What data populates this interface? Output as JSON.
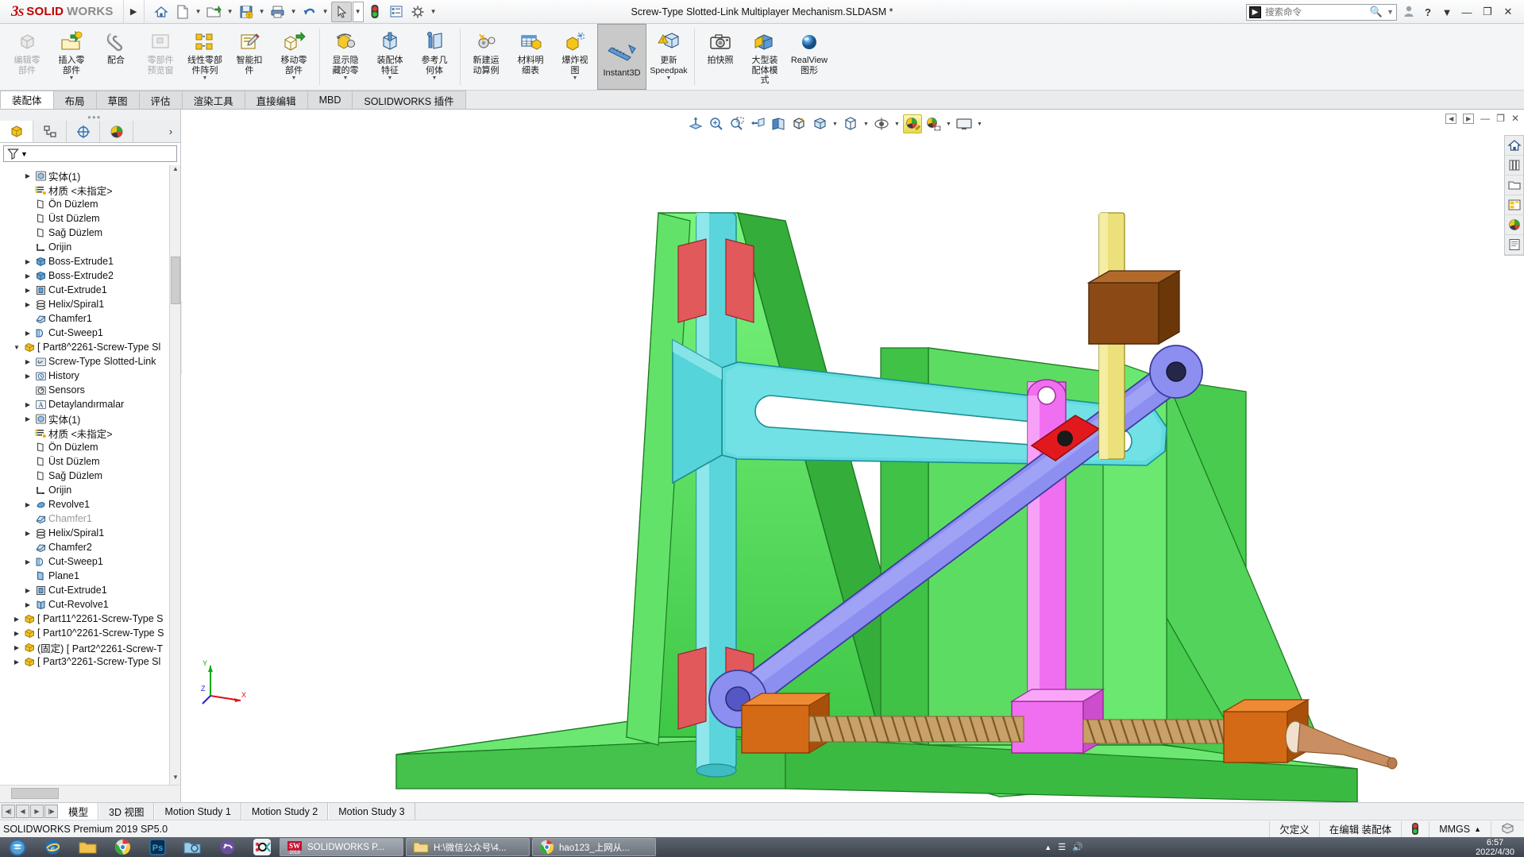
{
  "titlebar": {
    "brand_ds": "3S",
    "brand_solid": "SOLID",
    "brand_works": "WORKS",
    "document_title": "Screw-Type Slotted-Link Multiplayer Mechanism.SLDASM *",
    "quick_access": [
      {
        "name": "home-icon",
        "label": "⌂"
      },
      {
        "name": "new-document-icon",
        "label": "὜B"
      },
      {
        "name": "open-folder-icon",
        "label": "open"
      },
      {
        "name": "save-icon",
        "label": "save"
      },
      {
        "name": "print-icon",
        "label": "print"
      },
      {
        "name": "undo-icon",
        "label": "undo"
      },
      {
        "name": "select-cursor-icon",
        "label": "select"
      },
      {
        "name": "rebuild-traffic-light-icon",
        "label": "rebuild"
      },
      {
        "name": "options-list-icon",
        "label": "list"
      },
      {
        "name": "settings-gear-icon",
        "label": "gear"
      }
    ],
    "search": {
      "placeholder": "搜索命令",
      "value": ""
    },
    "user_icon": "user-icon",
    "help_label": "?",
    "minimize": "—",
    "restore": "❐",
    "close": "✕"
  },
  "ribbon": {
    "items": [
      {
        "label": "编辑零\n部件",
        "name": "edit-component-button",
        "enabled": false,
        "icon": "edit-component-icon"
      },
      {
        "label": "插入零\n部件",
        "name": "insert-components-button",
        "enabled": true,
        "icon": "insert-component-icon",
        "caret": true
      },
      {
        "label": "配合",
        "name": "mate-button",
        "enabled": true,
        "icon": "mate-icon"
      },
      {
        "label": "零部件\n预览窗",
        "name": "component-preview-window-button",
        "enabled": false,
        "icon": "component-preview-icon"
      },
      {
        "label": "线性零部\n件阵列",
        "name": "linear-component-pattern-button",
        "enabled": true,
        "icon": "linear-pattern-icon",
        "caret": true
      },
      {
        "label": "智能扣\n件",
        "name": "smart-fasteners-button",
        "enabled": true,
        "icon": "smart-fastener-icon"
      },
      {
        "label": "移动零\n部件",
        "name": "move-component-button",
        "enabled": true,
        "icon": "move-component-icon",
        "caret": true
      },
      {
        "sep": true
      },
      {
        "label": "显示隐\n藏的零",
        "name": "show-hidden-components-button",
        "enabled": true,
        "icon": "show-hidden-icon",
        "caret": true
      },
      {
        "label": "装配体\n特征",
        "name": "assembly-features-button",
        "enabled": true,
        "icon": "assembly-feature-icon",
        "caret": true
      },
      {
        "label": "参考几\n何体",
        "name": "reference-geometry-button",
        "enabled": true,
        "icon": "reference-geometry-icon",
        "caret": true
      },
      {
        "sep": true
      },
      {
        "label": "新建运\n动算例",
        "name": "new-motion-study-button",
        "enabled": true,
        "icon": "motion-study-icon"
      },
      {
        "label": "材料明\n细表",
        "name": "bill-of-materials-button",
        "enabled": true,
        "icon": "bom-icon"
      },
      {
        "label": "爆炸视\n图",
        "name": "exploded-view-button",
        "enabled": true,
        "icon": "exploded-view-icon",
        "caret": true
      },
      {
        "label": "Instant3D",
        "name": "instant3d-button",
        "enabled": true,
        "active": true,
        "icon": "instant3d-icon"
      },
      {
        "label": "更新\nSpeedpak",
        "name": "update-speedpak-button",
        "enabled": true,
        "icon": "update-speedpak-icon",
        "caret": true
      },
      {
        "sep": true
      },
      {
        "label": "拍快照",
        "name": "take-snapshot-button",
        "enabled": true,
        "icon": "snapshot-camera-icon"
      },
      {
        "label": "大型装\n配体模\n式",
        "name": "large-assembly-mode-button",
        "enabled": true,
        "icon": "large-assembly-icon"
      },
      {
        "label": "RealView\n图形",
        "name": "realview-graphics-button",
        "enabled": true,
        "icon": "realview-sphere-icon"
      }
    ]
  },
  "tabs": [
    {
      "label": "装配体",
      "name": "tab-assembly",
      "selected": true
    },
    {
      "label": "布局",
      "name": "tab-layout",
      "selected": false
    },
    {
      "label": "草图",
      "name": "tab-sketch",
      "selected": false
    },
    {
      "label": "评估",
      "name": "tab-evaluate",
      "selected": false
    },
    {
      "label": "渲染工具",
      "name": "tab-render-tools",
      "selected": false
    },
    {
      "label": "直接编辑",
      "name": "tab-direct-editing",
      "selected": false
    },
    {
      "label": "MBD",
      "name": "tab-mbd",
      "selected": false
    },
    {
      "label": "SOLIDWORKS 插件",
      "name": "tab-solidworks-addins",
      "selected": false
    }
  ],
  "left_panel": {
    "tabs": [
      {
        "name": "feature-manager-tab",
        "icon": "feature-tree-icon",
        "selected": true
      },
      {
        "name": "property-manager-tab",
        "icon": "property-manager-icon",
        "selected": false
      },
      {
        "name": "configuration-manager-tab",
        "icon": "configuration-icon",
        "selected": false
      },
      {
        "name": "display-manager-tab",
        "icon": "display-manager-icon",
        "selected": false
      }
    ],
    "filter_placeholder": "",
    "tree": [
      {
        "label": "实体(1)",
        "indent": 2,
        "arrow": true,
        "icon": "solid-bodies-icon"
      },
      {
        "label": "材质 <未指定>",
        "indent": 2,
        "arrow": false,
        "icon": "material-icon"
      },
      {
        "label": "Ön Düzlem",
        "indent": 2,
        "arrow": false,
        "icon": "plane-icon"
      },
      {
        "label": "Üst Düzlem",
        "indent": 2,
        "arrow": false,
        "icon": "plane-icon"
      },
      {
        "label": "Sağ Düzlem",
        "indent": 2,
        "arrow": false,
        "icon": "plane-icon"
      },
      {
        "label": "Orijin",
        "indent": 2,
        "arrow": false,
        "icon": "origin-icon"
      },
      {
        "label": "Boss-Extrude1",
        "indent": 2,
        "arrow": true,
        "icon": "boss-extrude-icon"
      },
      {
        "label": "Boss-Extrude2",
        "indent": 2,
        "arrow": true,
        "icon": "boss-extrude-icon"
      },
      {
        "label": "Cut-Extrude1",
        "indent": 2,
        "arrow": true,
        "icon": "cut-extrude-icon"
      },
      {
        "label": "Helix/Spiral1",
        "indent": 2,
        "arrow": true,
        "icon": "helix-icon"
      },
      {
        "label": "Chamfer1",
        "indent": 2,
        "arrow": false,
        "icon": "chamfer-icon"
      },
      {
        "label": "Cut-Sweep1",
        "indent": 2,
        "arrow": true,
        "icon": "cut-sweep-icon"
      },
      {
        "label": "[ Part8^2261-Screw-Type Sl",
        "indent": 1,
        "arrow": true,
        "expanded": true,
        "icon": "component-icon"
      },
      {
        "label": "Screw-Type Slotted-Link",
        "indent": 2,
        "arrow": true,
        "icon": "mates-folder-icon"
      },
      {
        "label": "History",
        "indent": 2,
        "arrow": true,
        "icon": "history-icon"
      },
      {
        "label": "Sensors",
        "indent": 2,
        "arrow": false,
        "icon": "sensors-icon"
      },
      {
        "label": "Detaylandırmalar",
        "indent": 2,
        "arrow": true,
        "icon": "annotations-icon"
      },
      {
        "label": "实体(1)",
        "indent": 2,
        "arrow": true,
        "icon": "solid-bodies-icon"
      },
      {
        "label": "材质 <未指定>",
        "indent": 2,
        "arrow": false,
        "icon": "material-icon"
      },
      {
        "label": "Ön Düzlem",
        "indent": 2,
        "arrow": false,
        "icon": "plane-icon"
      },
      {
        "label": "Üst Düzlem",
        "indent": 2,
        "arrow": false,
        "icon": "plane-icon"
      },
      {
        "label": "Sağ Düzlem",
        "indent": 2,
        "arrow": false,
        "icon": "plane-icon"
      },
      {
        "label": "Orijin",
        "indent": 2,
        "arrow": false,
        "icon": "origin-icon"
      },
      {
        "label": "Revolve1",
        "indent": 2,
        "arrow": true,
        "icon": "revolve-icon"
      },
      {
        "label": "Chamfer1",
        "indent": 2,
        "arrow": false,
        "icon": "chamfer-icon",
        "greyed": true
      },
      {
        "label": "Helix/Spiral1",
        "indent": 2,
        "arrow": true,
        "icon": "helix-icon"
      },
      {
        "label": "Chamfer2",
        "indent": 2,
        "arrow": false,
        "icon": "chamfer-icon"
      },
      {
        "label": "Cut-Sweep1",
        "indent": 2,
        "arrow": true,
        "icon": "cut-sweep-icon"
      },
      {
        "label": "Plane1",
        "indent": 2,
        "arrow": false,
        "icon": "plane-blue-icon"
      },
      {
        "label": "Cut-Extrude1",
        "indent": 2,
        "arrow": true,
        "icon": "cut-extrude-icon"
      },
      {
        "label": "Cut-Revolve1",
        "indent": 2,
        "arrow": true,
        "icon": "cut-revolve-icon"
      },
      {
        "label": "[ Part11^2261-Screw-Type S",
        "indent": 1,
        "arrow": true,
        "icon": "component-icon"
      },
      {
        "label": "[ Part10^2261-Screw-Type S",
        "indent": 1,
        "arrow": true,
        "icon": "component-icon"
      },
      {
        "label": "(固定) [ Part2^2261-Screw-T",
        "indent": 1,
        "arrow": true,
        "icon": "component-icon"
      },
      {
        "label": "[ Part3^2261-Screw-Type Sl",
        "indent": 1,
        "arrow": true,
        "icon": "component-icon"
      }
    ]
  },
  "viewport": {
    "hud": [
      {
        "name": "zoom-to-fit-icon",
        "label": "fit"
      },
      {
        "name": "zoom-to-area-icon",
        "label": "area"
      },
      {
        "name": "previous-view-icon",
        "label": "prev"
      },
      {
        "name": "section-view-icon",
        "label": "section"
      },
      {
        "name": "view-orientation-icon",
        "label": "orient"
      },
      {
        "name": "display-style-icon",
        "label": "style",
        "caret": true
      },
      {
        "name": "hide-show-items-icon",
        "label": "hideshow",
        "caret": true
      },
      {
        "name": "edit-appearance-icon",
        "label": "appearance",
        "highlight": true
      },
      {
        "name": "apply-scene-icon",
        "label": "scene",
        "caret": true
      },
      {
        "name": "view-settings-icon",
        "label": "viewsettings",
        "caret": true
      }
    ],
    "window_buttons": [
      {
        "name": "restore-down-left-button",
        "label": "◁"
      },
      {
        "name": "restore-down-right-button",
        "label": "▷"
      },
      {
        "name": "minimize-doc-button",
        "label": "—"
      },
      {
        "name": "maximize-doc-button",
        "label": "❐"
      },
      {
        "name": "close-doc-button",
        "label": "✕"
      }
    ],
    "right_dock": [
      {
        "name": "sw-resources-home-icon"
      },
      {
        "name": "design-library-icon"
      },
      {
        "name": "file-explorer-icon"
      },
      {
        "name": "view-palette-icon"
      },
      {
        "name": "appearances-scenes-icon"
      },
      {
        "name": "custom-properties-icon"
      }
    ],
    "triad": {
      "x": "X",
      "y": "Y",
      "z": "Z"
    },
    "model_colors": {
      "base_green": "#55e05a",
      "base_green_dark": "#2fae34",
      "cyan_arm": "#57d8dd",
      "blue_link": "#8c8ef0",
      "magenta_slider": "#f06ff0",
      "brown_block": "#8b4a15",
      "orange_block": "#d46a16",
      "red_pad": "#e2595c",
      "yellow_rod": "#ece07a",
      "tan_screw": "#d9a978"
    }
  },
  "bottom": {
    "nav_buttons": [
      "◀|",
      "◀",
      "▶",
      "|▶"
    ],
    "tabs": [
      {
        "label": "模型",
        "name": "bottom-tab-model",
        "selected": true
      },
      {
        "label": "3D 视图",
        "name": "bottom-tab-3d-views",
        "selected": false
      },
      {
        "label": "Motion Study 1",
        "name": "bottom-tab-motion-study-1",
        "selected": false
      },
      {
        "label": "Motion Study 2",
        "name": "bottom-tab-motion-study-2",
        "selected": false
      },
      {
        "label": "Motion Study 3",
        "name": "bottom-tab-motion-study-3",
        "selected": false
      }
    ]
  },
  "status": {
    "version": "SOLIDWORKS Premium 2019 SP5.0",
    "state": "欠定义",
    "editing": "在编辑 装配体",
    "rebuild_icon": "rebuild-traffic-light-icon",
    "units": "MMGS",
    "units_caret": "▲",
    "overlay_icon": "custom-icon"
  },
  "taskbar": {
    "start_icon": "windows-start-icon",
    "pinned": [
      {
        "name": "taskbar-ie-icon",
        "label": "e"
      },
      {
        "name": "taskbar-folder-icon",
        "label": "folder"
      },
      {
        "name": "taskbar-chrome-icon",
        "label": "chrome"
      },
      {
        "name": "taskbar-photoshop-icon",
        "label": "Ps"
      },
      {
        "name": "taskbar-explorer-icon",
        "label": "exp"
      },
      {
        "name": "taskbar-app-icon",
        "label": "app"
      },
      {
        "name": "taskbar-okc-icon",
        "label": "OK"
      }
    ],
    "windows": [
      {
        "name": "taskbar-window-solidworks",
        "label": "SOLIDWORKS P...",
        "icon": "solidworks-2019-icon"
      },
      {
        "name": "taskbar-window-folder",
        "label": "H:\\微信公众号\\4...",
        "icon": "folder-icon"
      },
      {
        "name": "taskbar-window-browser",
        "label": "hao123_上网从...",
        "icon": "chrome-icon"
      }
    ],
    "clock_time": "6:57",
    "clock_date": "2022/4/30"
  }
}
